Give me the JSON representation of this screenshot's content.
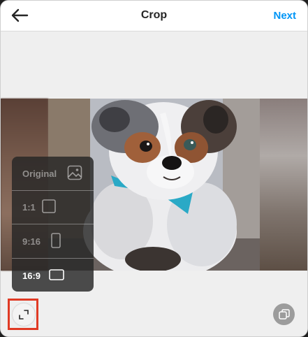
{
  "header": {
    "title": "Crop",
    "next_label": "Next"
  },
  "icons": {
    "back": "arrow-left-icon",
    "expand": "expand-arrows-icon",
    "multi": "multiple-images-icon",
    "original": "image-icon",
    "square": "square-icon",
    "portrait": "portrait-rect-icon",
    "landscape": "landscape-rect-icon"
  },
  "ratio_menu": {
    "items": [
      {
        "label": "Original",
        "active": false
      },
      {
        "label": "1:1",
        "active": false
      },
      {
        "label": "9:16",
        "active": false
      },
      {
        "label": "16:9",
        "active": true
      }
    ]
  },
  "colors": {
    "accent": "#0095f6",
    "highlight": "#e03a24"
  }
}
